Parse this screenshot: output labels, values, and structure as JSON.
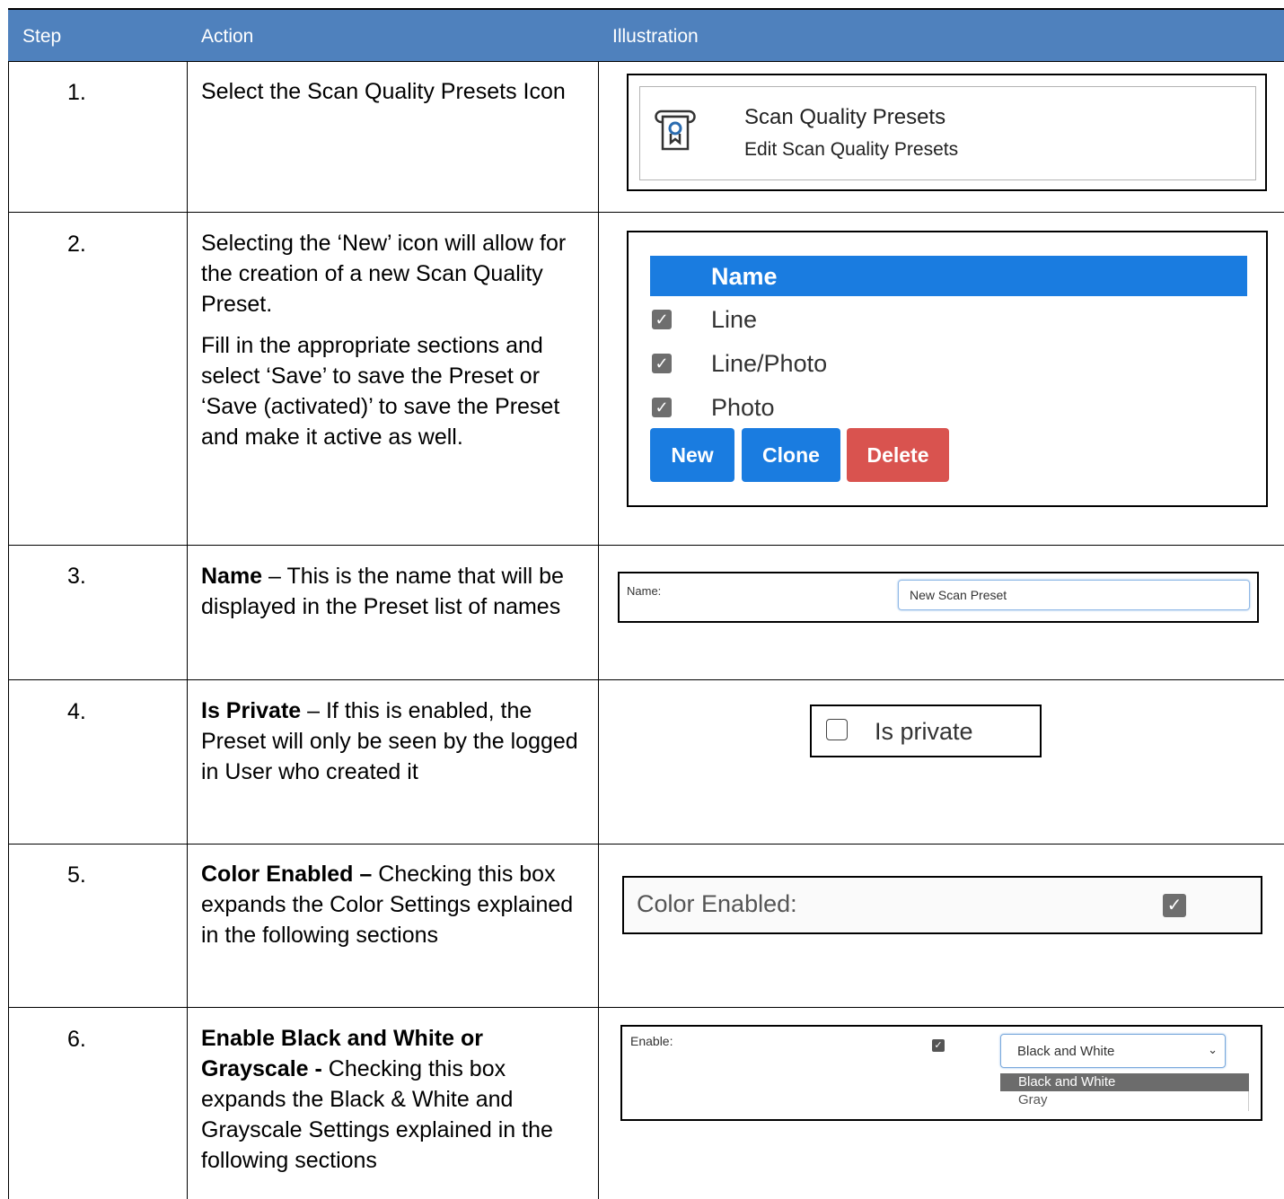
{
  "header": {
    "col_step": "Step",
    "col_action": "Action",
    "col_illustration": "Illustration"
  },
  "rows": [
    {
      "step": "1.",
      "action": [
        "Select the Scan Quality Presets Icon"
      ]
    },
    {
      "step": "2.",
      "action": [
        "Selecting the ‘New’ icon will allow for the creation of a new Scan Quality Preset.",
        "Fill in the appropriate sections and select ‘Save’ to save the Preset or ‘Save (activated)’ to save the Preset and make it active as well."
      ]
    },
    {
      "step": "3.",
      "action_bold": "Name",
      "action_rest": " – This is the name that will be displayed in the Preset list of names"
    },
    {
      "step": "4.",
      "action_bold": "Is Private",
      "action_rest": " – If this is enabled, the Preset will only be seen by the logged in User who created it"
    },
    {
      "step": "5.",
      "action_bold": "Color Enabled –",
      "action_rest": " Checking this box expands the Color Settings explained in the following sections"
    },
    {
      "step": "6.",
      "action_bold": "Enable Black and White or Grayscale -",
      "action_rest": " Checking this box expands the Black & White and Grayscale Settings explained in the following sections"
    }
  ],
  "illustration1": {
    "title": "Scan Quality Presets",
    "subtitle": "Edit Scan Quality Presets",
    "icon": "scan-preset-icon"
  },
  "illustration2": {
    "header": "Name",
    "items": [
      "Line",
      "Line/Photo",
      "Photo"
    ],
    "buttons": {
      "new": "New",
      "clone": "Clone",
      "delete": "Delete"
    },
    "colors": {
      "header": "#1a7ce0",
      "primary": "#1a7ce0",
      "danger": "#d9534f"
    }
  },
  "illustration3": {
    "label": "Name:",
    "value": "New Scan Preset"
  },
  "illustration4": {
    "label": "Is private",
    "checked": false
  },
  "illustration5": {
    "label": "Color Enabled:",
    "checked": true
  },
  "illustration6": {
    "label": "Enable:",
    "checked": true,
    "selected": "Black and White",
    "options": [
      "Black and White",
      "Gray"
    ]
  },
  "colors": {
    "header_bg": "#4F81BD",
    "header_text": "#FFFFFF"
  }
}
